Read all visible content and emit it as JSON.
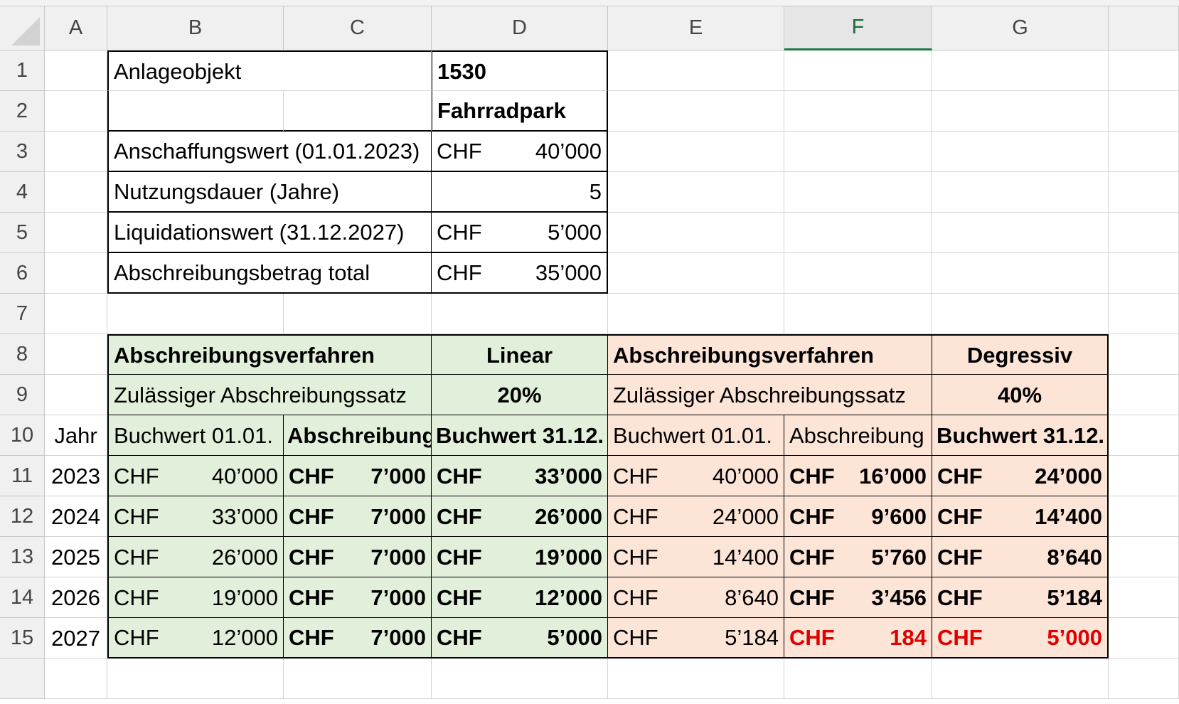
{
  "columns": [
    "A",
    "B",
    "C",
    "D",
    "E",
    "F",
    "G"
  ],
  "rows": [
    "1",
    "2",
    "3",
    "4",
    "5",
    "6",
    "7",
    "8",
    "9",
    "10",
    "11",
    "12",
    "13",
    "14",
    "15"
  ],
  "info": {
    "anlage_label": "Anlageobjekt",
    "anlage_nr": "1530",
    "anlage_name": "Fahrradpark",
    "anschaffung_label": "Anschaffungswert (01.01.2023)",
    "anschaffung_cur": "CHF",
    "anschaffung_val": "40’000",
    "nutzung_label": "Nutzungsdauer (Jahre)",
    "nutzung_val": "5",
    "liquidation_label": "Liquidationswert (31.12.2027)",
    "liquidation_cur": "CHF",
    "liquidation_val": "5’000",
    "abschreibung_label": "Abschreibungsbetrag total",
    "abschreibung_cur": "CHF",
    "abschreibung_val": "35’000"
  },
  "linear": {
    "verfahren_label": "Abschreibungsverfahren",
    "verfahren_val": "Linear",
    "satz_label": "Zulässiger Abschreibungssatz",
    "satz_val": "20%"
  },
  "degressiv": {
    "verfahren_label": "Abschreibungsverfahren",
    "verfahren_val": "Degressiv",
    "satz_label": "Zulässiger Abschreibungssatz",
    "satz_val": "40%"
  },
  "table_headers": {
    "jahr": "Jahr",
    "lin_bw_start": "Buchwert 01.01.",
    "lin_abschr": "Abschreibung",
    "lin_bw_end": "Buchwert 31.12.",
    "deg_bw_start": "Buchwert 01.01.",
    "deg_abschr": "Abschreibung",
    "deg_bw_end": "Buchwert 31.12."
  },
  "currency": "CHF",
  "years": [
    {
      "jahr": "2023",
      "lin_start": "40’000",
      "lin_abschr": "7’000",
      "lin_end": "33’000",
      "deg_start": "40’000",
      "deg_abschr": "16’000",
      "deg_end": "24’000"
    },
    {
      "jahr": "2024",
      "lin_start": "33’000",
      "lin_abschr": "7’000",
      "lin_end": "26’000",
      "deg_start": "24’000",
      "deg_abschr": "9’600",
      "deg_end": "14’400"
    },
    {
      "jahr": "2025",
      "lin_start": "26’000",
      "lin_abschr": "7’000",
      "lin_end": "19’000",
      "deg_start": "14’400",
      "deg_abschr": "5’760",
      "deg_end": "8’640"
    },
    {
      "jahr": "2026",
      "lin_start": "19’000",
      "lin_abschr": "7’000",
      "lin_end": "12’000",
      "deg_start": "8’640",
      "deg_abschr": "3’456",
      "deg_end": "5’184"
    },
    {
      "jahr": "2027",
      "lin_start": "12’000",
      "lin_abschr": "7’000",
      "lin_end": "5’000",
      "deg_start": "5’184",
      "deg_abschr": "184",
      "deg_end": "5’000"
    }
  ],
  "colors": {
    "linear_fill": "#e2efda",
    "degressiv_fill": "#fce4d6",
    "highlight_red": "#e00000",
    "selected_column": "#1d7a44"
  }
}
